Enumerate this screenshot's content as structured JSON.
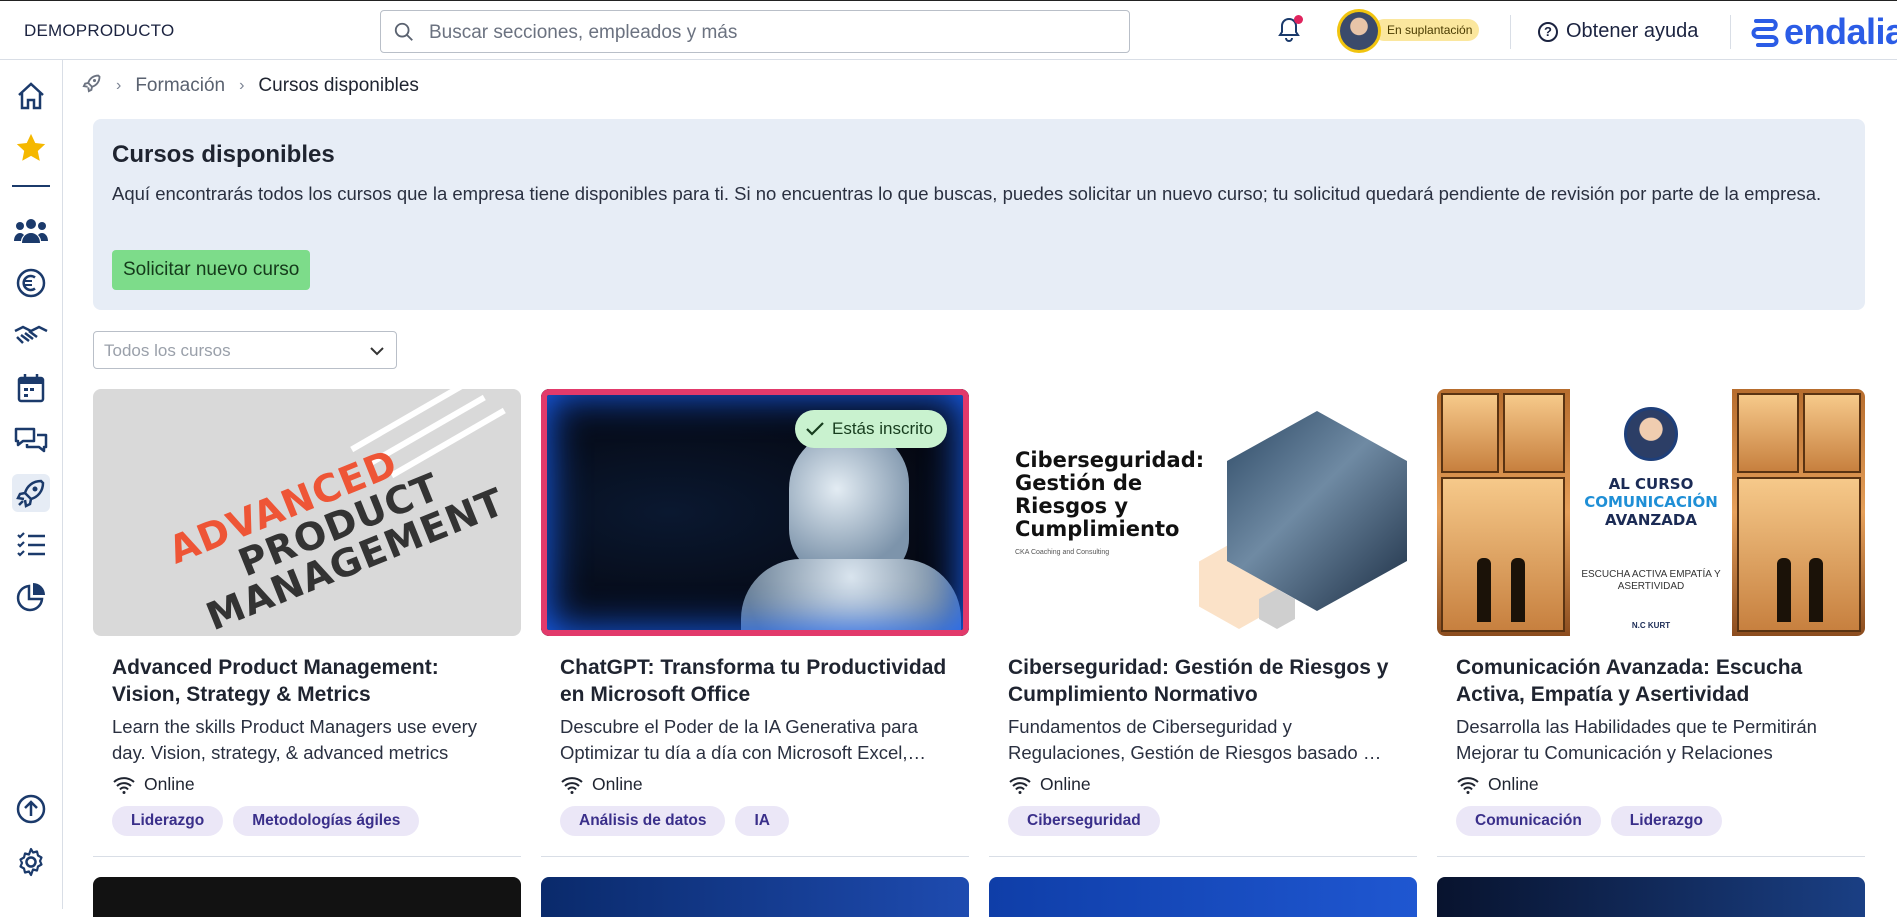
{
  "header": {
    "company": "DEMOPRODUCTO",
    "search_placeholder": "Buscar secciones, empleados y más",
    "impersonation_badge": "En suplantación",
    "help_label": "Obtener ayuda",
    "brand": "endalia"
  },
  "sidebar": {
    "items": [
      {
        "name": "home",
        "icon": "home-icon"
      },
      {
        "name": "favorites",
        "icon": "star-icon"
      },
      {
        "name": "employees",
        "icon": "people-icon"
      },
      {
        "name": "payroll",
        "icon": "euro-icon"
      },
      {
        "name": "agreements",
        "icon": "handshake-icon"
      },
      {
        "name": "calendar",
        "icon": "calendar-icon"
      },
      {
        "name": "chat",
        "icon": "chat-icon"
      },
      {
        "name": "training",
        "icon": "rocket-icon",
        "active": true
      },
      {
        "name": "tasks",
        "icon": "checklist-icon"
      },
      {
        "name": "reports",
        "icon": "pie-chart-icon"
      },
      {
        "name": "upload",
        "icon": "arrow-up-circle-icon"
      },
      {
        "name": "settings",
        "icon": "gear-icon"
      }
    ]
  },
  "breadcrumb": {
    "items": [
      "Formación",
      "Cursos disponibles"
    ]
  },
  "info": {
    "title": "Cursos disponibles",
    "text": "Aquí encontrarás todos los cursos que la empresa tiene disponibles para ti. Si no encuentras lo que buscas, puedes solicitar un nuevo curso; tu solicitud quedará pendiente de revisión por parte de la empresa.",
    "request_button": "Solicitar nuevo curso"
  },
  "filter": {
    "selected": "Todos los cursos"
  },
  "courses": [
    {
      "title": "Advanced Product Management: Vision, Strategy & Metrics",
      "description": "Learn the skills Product Managers use every day. Vision, strategy, & advanced metrics",
      "mode": "Online",
      "tags": [
        "Liderazgo",
        "Metodologías ágiles"
      ],
      "thumb_text": [
        "ADVANCED",
        "PRODUCT",
        "MANAGEMENT"
      ]
    },
    {
      "title": "ChatGPT: Transforma tu Productividad en Microsoft Office",
      "description": "Descubre el Poder de la IA Generativa para Optimizar tu día a día con Microsoft Excel, Word",
      "mode": "Online",
      "enrolled": "Estás inscrito",
      "tags": [
        "Análisis de datos",
        "IA"
      ]
    },
    {
      "title": "Ciberseguridad: Gestión de Riesgos y Cumplimiento Normativo",
      "description": "Fundamentos de Ciberseguridad y Regulaciones, Gestión de Riesgos basado en normas",
      "mode": "Online",
      "tags": [
        "Ciberseguridad"
      ],
      "thumb_title": "Ciberseguridad: Gestión de Riesgos y Cumplimiento",
      "thumb_sub": "CKA Coaching and Consulting"
    },
    {
      "title": "Comunicación Avanzada: Escucha Activa, Empatía y Asertividad",
      "description": "Desarrolla las Habilidades que te Permitirán Mejorar tu Comunicación y Relaciones",
      "mode": "Online",
      "tags": [
        "Comunicación",
        "Liderazgo"
      ],
      "thumb_l1": "AL CURSO",
      "thumb_l1b": "COMUNICACIÓN",
      "thumb_l1c": "AVANZADA",
      "thumb_l2": "ESCUCHA ACTIVA EMPATÍA Y ASERTIVIDAD",
      "thumb_l3": "N.C KURT"
    }
  ]
}
